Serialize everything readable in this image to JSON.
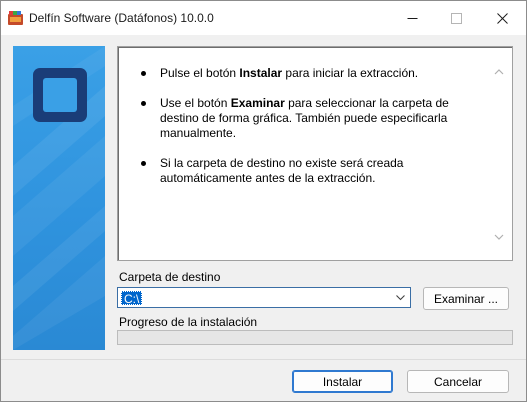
{
  "window": {
    "title": "Delfín Software (Datáfonos) 10.0.0"
  },
  "titlebar": {
    "buttons": [
      "minimize",
      "maximize",
      "close"
    ]
  },
  "info": {
    "items": [
      {
        "pre": "Pulse el botón ",
        "bold": "Instalar",
        "post": " para iniciar la extracción."
      },
      {
        "pre": "Use el botón ",
        "bold": "Examinar",
        "post": " para seleccionar la carpeta de destino de forma gráfica. También puede especificarla manualmente."
      },
      {
        "pre": "Si la carpeta de destino no existe será creada automáticamente antes de la extracción.",
        "bold": "",
        "post": ""
      }
    ]
  },
  "destination": {
    "label": "Carpeta de destino",
    "value": "C:\\"
  },
  "browse_label": "Examinar ...",
  "progress": {
    "label": "Progreso de la instalación",
    "value": 0
  },
  "buttons": {
    "install": "Instalar",
    "cancel": "Cancelar"
  },
  "colors": {
    "side_panel": "#3aa0e6",
    "logo": "#1a3d78",
    "focus_border": "#2f79d0",
    "selection": "#0066cc"
  }
}
